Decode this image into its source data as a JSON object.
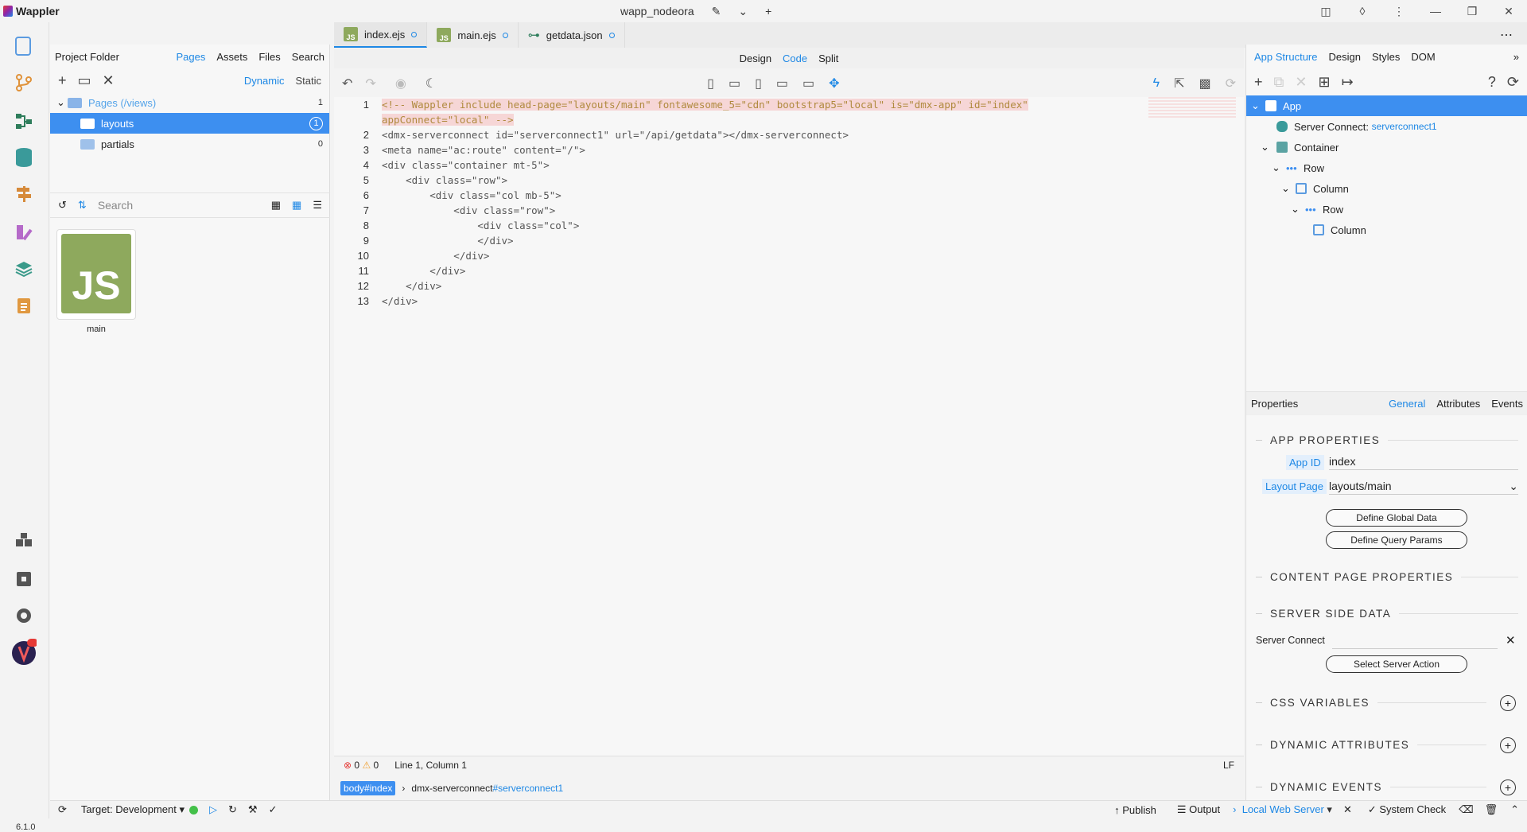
{
  "app": {
    "name": "Wappler",
    "project": "wapp_nodeora",
    "version": "6.1.0"
  },
  "project_panel": {
    "title": "Project Folder",
    "tabs": [
      "Pages",
      "Assets",
      "Files",
      "Search"
    ],
    "modes": [
      "Dynamic",
      "Static"
    ],
    "tree": [
      {
        "label": "Pages (/views)",
        "count": "1"
      },
      {
        "label": "layouts",
        "count": "1"
      },
      {
        "label": "partials",
        "count": "0"
      }
    ],
    "search_placeholder": "Search",
    "file": {
      "badge": "JS",
      "name": "main"
    }
  },
  "editor": {
    "tabs": [
      {
        "label": "index.ejs",
        "badge": "JS"
      },
      {
        "label": "main.ejs",
        "badge": "JS"
      },
      {
        "label": "getdata.json"
      }
    ],
    "modes": [
      "Design",
      "Code",
      "Split"
    ],
    "lines": [
      {
        "n": "1",
        "text": "<!-- Wappler include head-page=\"layouts/main\" fontawesome_5=\"cdn\" bootstrap5=\"local\" is=\"dmx-app\" id=\"index\""
      },
      {
        "n": "",
        "text": "appConnect=\"local\" -->"
      },
      {
        "n": "2",
        "text": "<dmx-serverconnect id=\"serverconnect1\" url=\"/api/getdata\"></dmx-serverconnect>"
      },
      {
        "n": "3",
        "text": "<meta name=\"ac:route\" content=\"/\">"
      },
      {
        "n": "4",
        "text": "<div class=\"container mt-5\">"
      },
      {
        "n": "5",
        "text": "    <div class=\"row\">"
      },
      {
        "n": "6",
        "text": "        <div class=\"col mb-5\">"
      },
      {
        "n": "7",
        "text": "            <div class=\"row\">"
      },
      {
        "n": "8",
        "text": "                <div class=\"col\">"
      },
      {
        "n": "9",
        "text": "                </div>"
      },
      {
        "n": "10",
        "text": "            </div>"
      },
      {
        "n": "11",
        "text": "        </div>"
      },
      {
        "n": "12",
        "text": "    </div>"
      },
      {
        "n": "13",
        "text": "</div>"
      }
    ],
    "status": {
      "errors": "0",
      "warnings": "0",
      "position": "Line 1, Column 1",
      "eol": "LF"
    },
    "breadcrumb": {
      "active": "body#index",
      "tag": "dmx-serverconnect",
      "id": "#serverconnect1"
    }
  },
  "right_panel": {
    "tabs": [
      "App Structure",
      "Design",
      "Styles",
      "DOM"
    ],
    "structure": [
      {
        "label": "App",
        "depth": 0
      },
      {
        "label": "Server Connect:",
        "extra": "serverconnect1",
        "depth": 1
      },
      {
        "label": "Container",
        "depth": 1
      },
      {
        "label": "Row",
        "depth": 2
      },
      {
        "label": "Column",
        "depth": 3
      },
      {
        "label": "Row",
        "depth": 4
      },
      {
        "label": "Column",
        "depth": 5
      }
    ],
    "properties": {
      "title": "Properties",
      "tabs": [
        "General",
        "Attributes",
        "Events"
      ],
      "sections": [
        "APP PROPERTIES",
        "CONTENT PAGE PROPERTIES",
        "SERVER SIDE DATA",
        "CSS VARIABLES",
        "DYNAMIC ATTRIBUTES",
        "DYNAMIC EVENTS"
      ],
      "app_id_label": "App ID",
      "app_id": "index",
      "layout_label": "Layout Page",
      "layout": "layouts/main",
      "btn_global": "Define Global Data",
      "btn_query": "Define Query Params",
      "server_connect_label": "Server Connect",
      "btn_select_action": "Select Server Action"
    }
  },
  "bottom": {
    "target": "Target: Development",
    "publish": "Publish",
    "output": "Output",
    "server": "Local Web Server",
    "check": "System Check"
  }
}
